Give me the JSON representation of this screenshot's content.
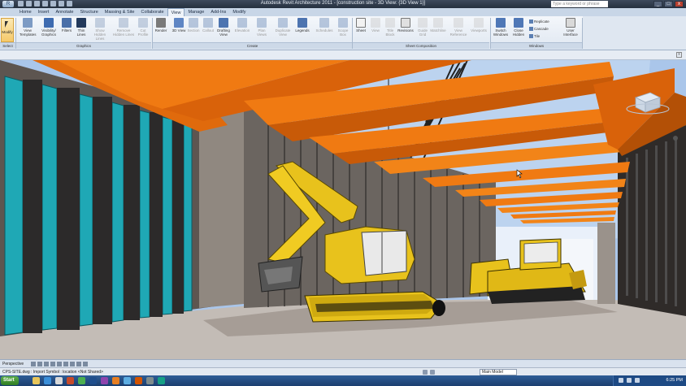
{
  "window": {
    "app_button": "R",
    "title": "Autodesk Revit Architecture 2011 - [construction site - 3D View: {3D View 1}]",
    "search_placeholder": "Type a keyword or phrase",
    "minimize": "_",
    "maximize": "□",
    "close": "x"
  },
  "ribbon_tabs": [
    "Home",
    "Insert",
    "Annotate",
    "Structure",
    "Massing & Site",
    "Collaborate",
    "View",
    "Manage",
    "Add-Ins",
    "Modify"
  ],
  "active_tab": "View",
  "ribbon": {
    "modify_label": "Modify",
    "select_panel": "Select",
    "graphics_buttons": [
      "View Templates",
      "Visibility/ Graphics",
      "Filters",
      "Thin Lines",
      "Show Hidden Lines",
      "Remove Hidden Lines",
      "Cut Profile"
    ],
    "graphics_panel": "Graphics",
    "create_buttons": [
      "Render",
      "3D View",
      "Section",
      "Callout",
      "Drafting View",
      "Elevation",
      "Plan Views",
      "Duplicate View",
      "Legends",
      "Schedules",
      "Scope Box"
    ],
    "create_panel": "Create",
    "sheet_buttons": [
      "Sheet",
      "View",
      "Title Block",
      "Revisions",
      "Guide Grid",
      "Matchline",
      "View Reference",
      "Viewports"
    ],
    "sheet_panel": "Sheet Composition",
    "window_buttons": [
      "Switch Windows",
      "Close Hidden",
      "Replicate",
      "Cascade",
      "Tile",
      "User Interface"
    ],
    "window_panel": "Windows"
  },
  "view_control_bar": {
    "view_type": "Perspective"
  },
  "status_bar": {
    "message": "CPS-SITE.dwg : Import Symbol : location <Not Shared>",
    "model": "Main Model"
  },
  "taskbar": {
    "start_label": "Start",
    "clock": "6:25 PM"
  },
  "colors": {
    "beam": "#f07a12",
    "excavator": "#e8c21c",
    "glass": "#1fa8b5",
    "wall": "#6e6660",
    "sky": "#aac6ea"
  }
}
